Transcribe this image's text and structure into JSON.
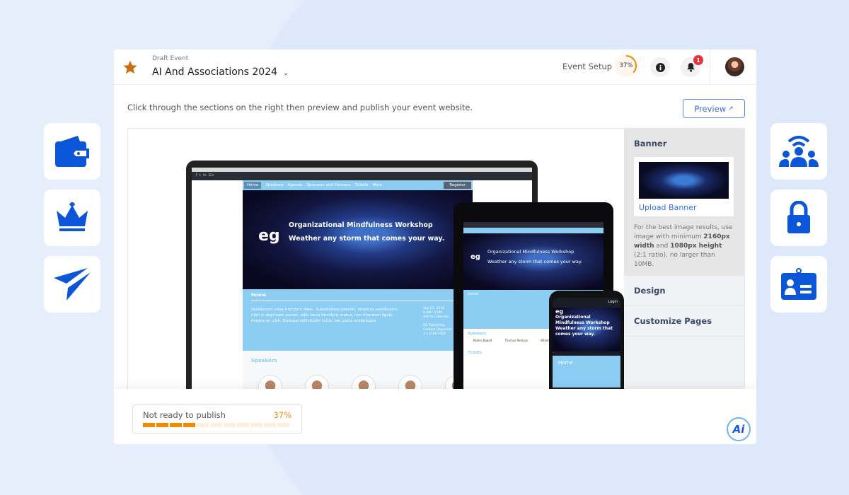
{
  "header": {
    "subtitle": "Draft Event",
    "title": "AI And Associations 2024",
    "setup_label": "Event Setup",
    "setup_progress": "37%",
    "notification_count": "1"
  },
  "instruction": "Click through the sections on the right then preview and publish your event website.",
  "preview_label": "Preview",
  "mockup": {
    "nav": [
      "Home",
      "Speakers",
      "Agenda",
      "Sponsors and Partners",
      "Tickets",
      "More"
    ],
    "register": "Register",
    "login": "Login",
    "logo": "eg",
    "banner_title": "Organizational Mindfulness Workshop",
    "banner_tagline": "Weather any storm that comes your way.",
    "home_heading": "Home",
    "home_text": "Vestibulum vitae tincidunt diam. Suspendisse potenti. Vivamus vestibulum, nibh in dignissim auctor, odio lacus tincidunt metus, non interdum ligula magna ac nibh. Quisque sollicitudin tortor nec porta scelerisque.",
    "date": "Sep 21, 2018",
    "time": "9 AM - 9 PM",
    "add_calendar": "Add to Calendar",
    "org": "EG Publishing",
    "contact": "Contact Organizer",
    "phone": "+1 1100 4500",
    "speakers_heading": "Speakers",
    "tickets_heading": "Tickets",
    "speaker_names": [
      "Muller Babolt",
      "Thomas Renfuro",
      "Wheit Sheiker"
    ]
  },
  "panel": {
    "banner_heading": "Banner",
    "upload_label": "Upload Banner",
    "note_pre": "For the best image results, use image with minimum ",
    "note_w": "2160px width",
    "note_mid": " and ",
    "note_h": "1080px height",
    "note_post": " (2:1 ratio), no larger than 10MB.",
    "design": "Design",
    "customize": "Customize Pages"
  },
  "footer": {
    "status": "Not ready to publish",
    "percent": "37%",
    "progress": 0.37,
    "ai_label": "Ai"
  },
  "colors": {
    "accent": "#1a56db",
    "progress": "#f08a00",
    "star": "#c8700f"
  },
  "side_icons": {
    "left": [
      "wallet-icon",
      "crown-icon",
      "paper-plane-icon"
    ],
    "right": [
      "community-broadcast-icon",
      "lock-icon",
      "id-badge-icon"
    ]
  }
}
